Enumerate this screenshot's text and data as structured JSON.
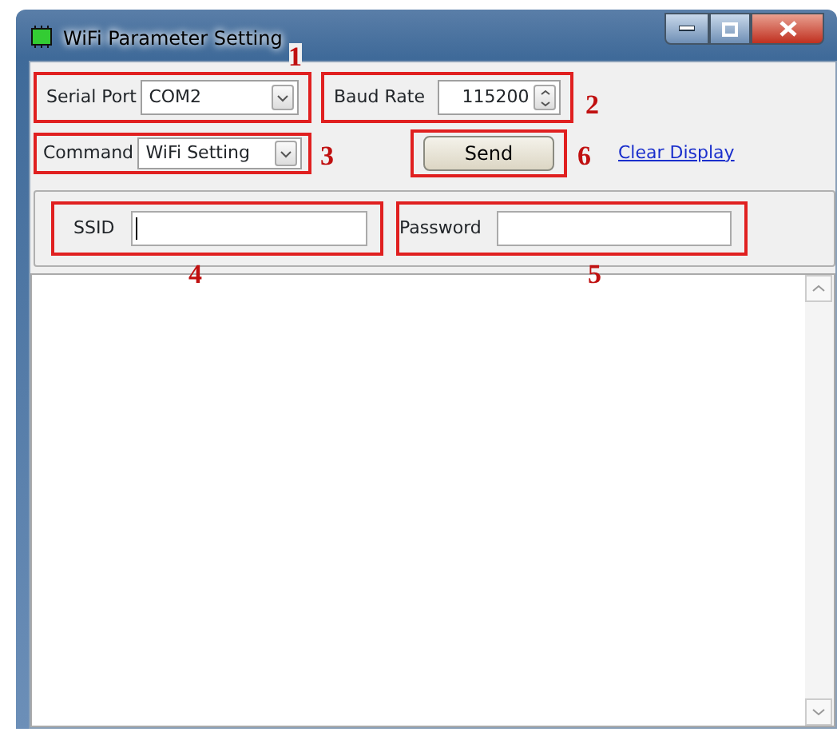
{
  "window": {
    "title": "WiFi Parameter Setting"
  },
  "serial_port": {
    "label": "Serial Port",
    "value": "COM2",
    "callout": "1"
  },
  "baud_rate": {
    "label": "Baud Rate",
    "value": "115200",
    "callout": "2"
  },
  "command": {
    "label": "Command",
    "value": "WiFi Setting",
    "callout": "3"
  },
  "send_button": {
    "label": "Send",
    "callout": "6"
  },
  "clear_display": {
    "label": "Clear Display"
  },
  "ssid": {
    "label": "SSID",
    "callout": "4"
  },
  "password": {
    "label": "Password",
    "callout": "5"
  }
}
